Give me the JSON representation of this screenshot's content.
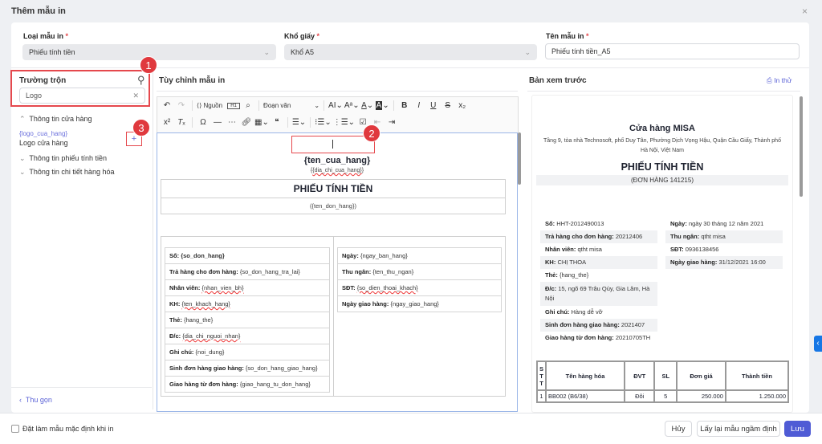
{
  "dialog": {
    "title": "Thêm mẫu in",
    "close": "×"
  },
  "form": {
    "type": {
      "label": "Loại mẫu in",
      "required": "*",
      "value": "Phiếu tính tiền"
    },
    "paper": {
      "label": "Khổ giấy",
      "required": "*",
      "value": "Khổ A5"
    },
    "name": {
      "label": "Tên mẫu in",
      "required": "*",
      "value": "Phiếu tính tiền_A5"
    }
  },
  "merge_fields": {
    "title": "Trường trộn",
    "search_value": "Logo",
    "groups": [
      {
        "label": "Thông tin cửa hàng",
        "expanded": true,
        "items": [
          {
            "code": "{logo_cua_hang}",
            "label": "Logo cửa hàng",
            "add": "+"
          }
        ]
      },
      {
        "label": "Thông tin phiếu tính tiền",
        "expanded": false
      },
      {
        "label": "Thông tin chi tiết hàng hóa",
        "expanded": false
      }
    ],
    "collapse": "Thu gọn"
  },
  "annotations": [
    "1",
    "2",
    "3"
  ],
  "editor": {
    "title": "Tùy chỉnh mẫu in",
    "toolbar": {
      "source": "Nguồn",
      "heading": "H1",
      "format": "Đoạn văn"
    },
    "store_name": "{ten_cua_hang}",
    "store_address": "{dia_chi_cua_hang}",
    "doc_title": "PHIẾU TÍNH TIỀN",
    "order_name": "({ten_don_hang})",
    "left_fields": [
      {
        "label": "Số:",
        "value": "{so_don_hang}"
      },
      {
        "label": "Trả hàng cho đơn hàng:",
        "value": "{so_don_hang_tra_lai}"
      },
      {
        "label": "Nhân viên:",
        "value": "{nhan_vien_bh}"
      },
      {
        "label": "KH:",
        "value": "{ten_khach_hang}"
      },
      {
        "label": "Thẻ:",
        "value": "{hang_the}"
      },
      {
        "label": "Đ/c:",
        "value": "{dia_chi_nguoi_nhan}"
      },
      {
        "label": "Ghi chú:",
        "value": "{noi_dung}"
      },
      {
        "label": "Sinh đơn hàng giao hàng:",
        "value": "{so_don_hang_giao_hang}"
      },
      {
        "label": "Giao hàng từ đơn hàng:",
        "value": "{giao_hang_tu_don_hang}"
      }
    ],
    "right_fields": [
      {
        "label": "Ngày:",
        "value": "{ngay_ban_hang}"
      },
      {
        "label": "Thu ngân:",
        "value": "{ten_thu_ngan}"
      },
      {
        "label": "SĐT:",
        "value": "{so_dien_thoai_khach}"
      },
      {
        "label": "Ngày giao hàng:",
        "value": "{ngay_giao_hang}"
      }
    ]
  },
  "preview": {
    "title": "Bản xem trước",
    "print_test": "In thử",
    "store_name": "Cửa hàng MISA",
    "store_address": "Tầng 9, tòa nhà Technosoft, phố Duy Tân, Phường Dịch Vọng Hậu, Quận Cầu Giấy, Thành phố Hà Nội, Việt Nam",
    "doc_title": "PHIẾU TÍNH TIỀN",
    "order_name": "(ĐƠN HÀNG 141215)",
    "left_fields": [
      {
        "label": "Số:",
        "value": "HHT-2012490013"
      },
      {
        "label": "Trả hàng cho đơn hàng:",
        "value": "20212406"
      },
      {
        "label": "Nhân viên:",
        "value": "qtht misa"
      },
      {
        "label": "KH:",
        "value": "CHỊ THOA"
      },
      {
        "label": "Thẻ:",
        "value": "{hang_the}"
      },
      {
        "label": "Đ/c:",
        "value": "15, ngõ 69 Trâu Qùy, Gia Lâm, Hà Nội"
      },
      {
        "label": "Ghi chú:",
        "value": "Hàng dễ vỡ"
      },
      {
        "label": "Sinh đơn hàng giao hàng:",
        "value": "2021407"
      },
      {
        "label": "Giao hàng từ đơn hàng:",
        "value": "20210705TH"
      }
    ],
    "right_fields": [
      {
        "label": "Ngày:",
        "value": "ngày 30 tháng 12 năm 2021"
      },
      {
        "label": "Thu ngân:",
        "value": "qtht misa"
      },
      {
        "label": "SĐT:",
        "value": "0936138456"
      },
      {
        "label": "Ngày giao hàng:",
        "value": "31/12/2021 16:00"
      }
    ],
    "table": {
      "headers": [
        "STT",
        "Tên hàng hóa",
        "ĐVT",
        "SL",
        "Đơn giá",
        "Thành tiền"
      ],
      "rows": [
        [
          "1",
          "BB002 (B6/38)",
          "Đôi",
          "5",
          "250.000",
          "1.250.000"
        ]
      ]
    }
  },
  "footer": {
    "default_checkbox": "Đặt làm mẫu mặc định khi in",
    "checked": false,
    "cancel": "Hủy",
    "reset": "Lấy lại mẫu ngầm định",
    "save": "Lưu"
  }
}
